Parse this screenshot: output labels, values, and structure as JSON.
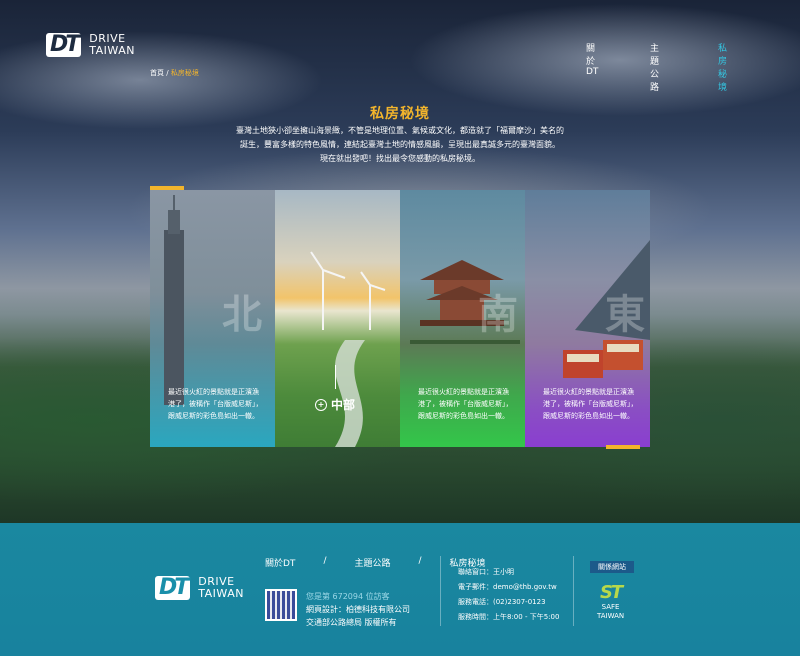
{
  "header": {
    "logo_mark": "DT",
    "logo_line1": "DRIVE",
    "logo_line2": "TAIWAN",
    "nav": [
      "關於DT",
      "主題公路",
      "私房秘境"
    ]
  },
  "breadcrumb": {
    "home": "首頁",
    "sep": "/",
    "current": "私房秘境"
  },
  "page": {
    "title": "私房秘境",
    "intro_line1": "臺灣土地狹小卻坐擁山海景緻，不管是地理位置、氣候或文化，都造就了「福爾摩沙」美名的",
    "intro_line2": "誕生，豐富多樣的特色風情，連結起臺灣土地的情感風韻，呈現出最真誠多元的臺灣面貌。",
    "intro_line3": "現在就出發吧！找出最令您感動的私房秘境。"
  },
  "cards": [
    {
      "region": "北",
      "text": "最近很火紅的景點就是正濱漁港了，被稱作「台版威尼斯」，跟威尼斯的彩色島如出一轍。"
    },
    {
      "region": "中部",
      "text": ""
    },
    {
      "region": "南",
      "text": "最近很火紅的景點就是正濱漁港了，被稱作「台版威尼斯」，跟威尼斯的彩色島如出一轍。"
    },
    {
      "region": "東",
      "text": "最近很火紅的景點就是正濱漁港了，被稱作「台版威尼斯」，跟威尼斯的彩色島如出一轍。"
    }
  ],
  "footer": {
    "links": [
      "關於DT",
      "/",
      "主題公路",
      "/",
      "私房秘境"
    ],
    "logo_mark": "DT",
    "logo_line1": "DRIVE",
    "logo_line2": "TAIWAN",
    "visits": "您是第 672094 位訪客",
    "design": "網頁設計：柏德科技有限公司",
    "owner": "交通部公路總局 版權所有",
    "contact_window": "聯絡窗口：王小明",
    "email": "電子郵件：demo@thb.gov.tw",
    "phone": "服務電話：(02)2307-0123",
    "hours": "服務時間：上午8:00 - 下午5:00",
    "related_label": "關係網站",
    "safe_mark": "ST",
    "safe_line1": "SAFE",
    "safe_line2": "TAIWAN"
  },
  "colors": {
    "accent": "#f3b52c",
    "nav_active": "#33c7e3",
    "footer": "#1a8faa"
  }
}
